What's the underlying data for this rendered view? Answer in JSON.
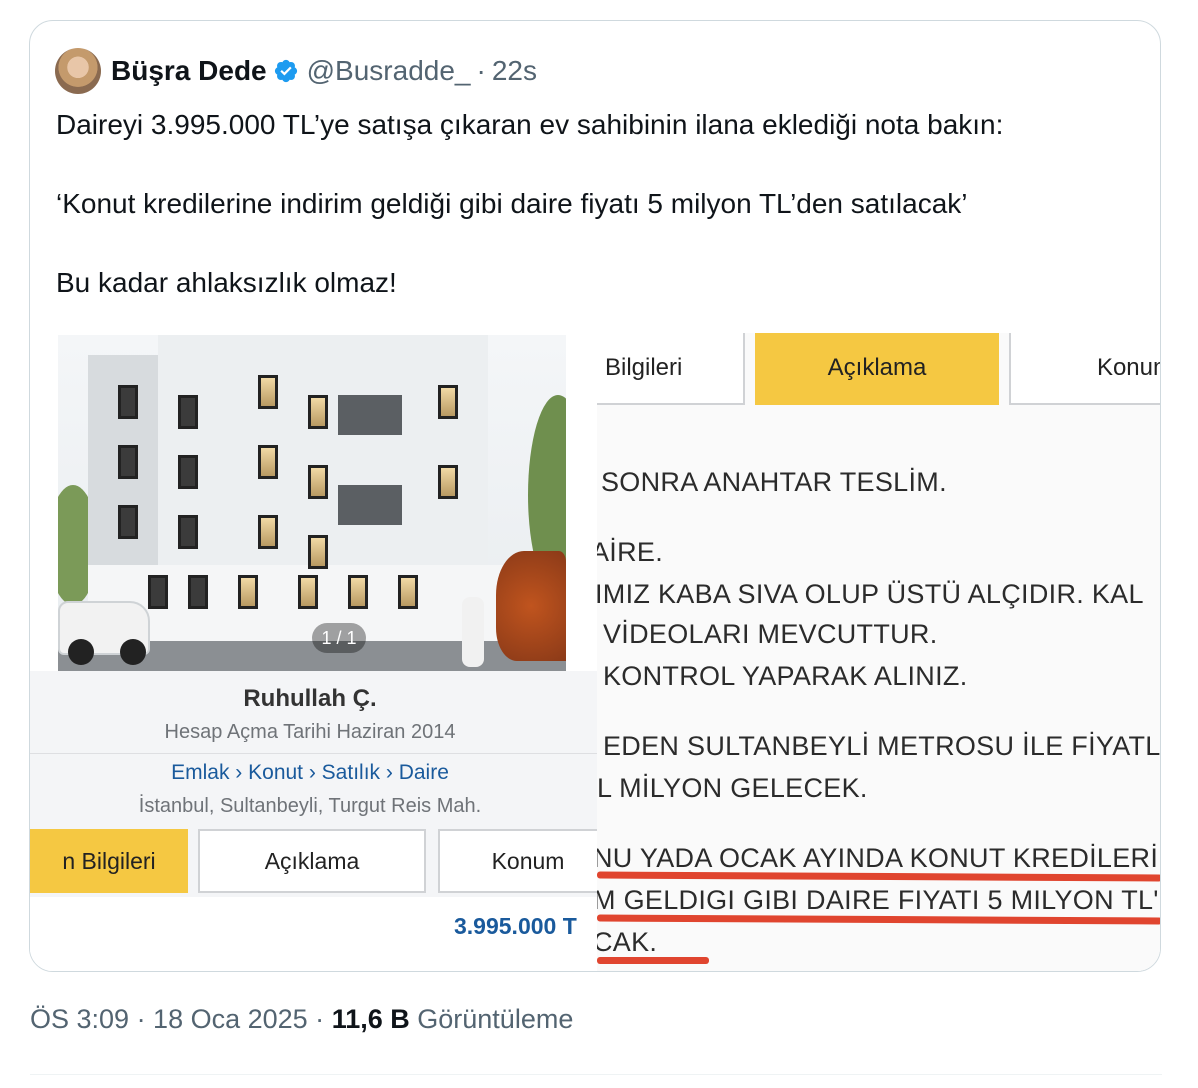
{
  "tweet": {
    "author_name": "Büşra Dede",
    "author_handle": "@Busradde_",
    "separator": "·",
    "time_ago": "22s",
    "lines": [
      "Daireyi 3.995.000 TL’ye satışa çıkaran ev sahibinin ilana eklediği nota bakın:",
      "‘Konut kredilerine indirim geldiği gibi daire fiyatı 5 milyon TL’den satılacak’",
      "Bu kadar ahlaksızlık olmaz!"
    ]
  },
  "left_image": {
    "counter": "1 / 1",
    "seller_name": "Ruhullah Ç.",
    "seller_since": "Hesap Açma Tarihi Haziran 2014",
    "breadcrumb": "Emlak › Konut › Satılık › Daire",
    "location": "İstanbul, Sultanbeyli, Turgut Reis Mah.",
    "tabs": [
      "n Bilgileri",
      "Açıklama",
      "Konum"
    ],
    "active_tab_index": 0,
    "price": "3.995.000 T"
  },
  "right_image": {
    "tabs": [
      "Bilgileri",
      "Açıklama",
      "Konum"
    ],
    "active_tab_index": 1,
    "lines": [
      "SONRA ANAHTAR TESLİM.",
      "AİRE.",
      "IMIZ KABA SIVA OLUP ÜSTÜ ALÇIDIR. KAL",
      "VİDEOLARI MEVCUTTUR.",
      "KONTROL YAPARAK ALINIZ.",
      "EDEN SULTANBEYLİ METROSU İLE FİYATL",
      "L MİLYON GELECEK.",
      "NU YADA OCAK AYINDA KONUT KREDİLERİ",
      "M GELDIGI GIBI DAIRE FIYATI 5 MILYON TL'D",
      "CAK."
    ],
    "underline_color": "#e0452f",
    "tab_active_color": "#f5c842"
  },
  "footer": {
    "timestamp": "ÖS 3:09 · 18 Oca 2025 ·",
    "views_count": "11,6 B",
    "views_label": "Görüntüleme"
  },
  "colors": {
    "text": "#0f1419",
    "secondary": "#536471",
    "verified": "#1d9bf0",
    "link": "#1a5a9c"
  }
}
